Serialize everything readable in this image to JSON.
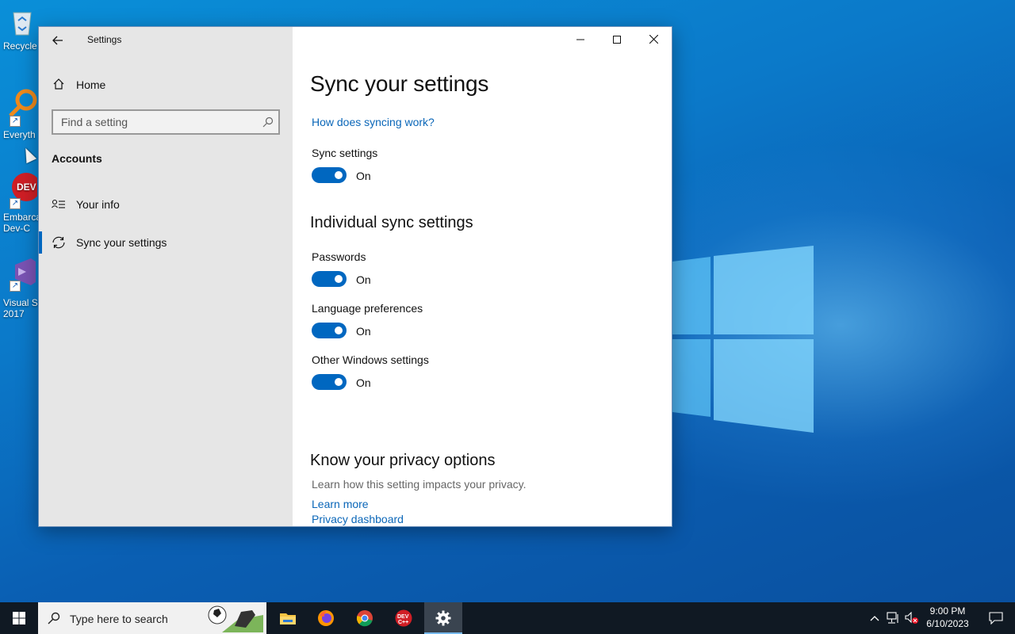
{
  "desktop": {
    "icons": [
      {
        "label": "Recycle"
      },
      {
        "label": "Everyth"
      },
      {
        "label": "Embarca\nDev-C"
      },
      {
        "label": "Visual St\n2017"
      }
    ]
  },
  "window": {
    "title": "Settings",
    "sidebar": {
      "home_label": "Home",
      "search_placeholder": "Find a setting",
      "section_title": "Accounts",
      "items": [
        {
          "label": "Your info",
          "icon": "person-card-icon"
        },
        {
          "label": "Sync your settings",
          "icon": "sync-icon",
          "active": true
        }
      ]
    },
    "content": {
      "title": "Sync your settings",
      "how_link": "How does syncing work?",
      "sync_settings_label": "Sync settings",
      "sync_settings_state": "On",
      "individual_heading": "Individual sync settings",
      "individual": [
        {
          "label": "Passwords",
          "state": "On"
        },
        {
          "label": "Language preferences",
          "state": "On"
        },
        {
          "label": "Other Windows settings",
          "state": "On"
        }
      ],
      "privacy_heading": "Know your privacy options",
      "privacy_text": "Learn how this setting impacts your privacy.",
      "learn_more": "Learn more",
      "privacy_dashboard": "Privacy dashboard"
    },
    "accent": "#0067c0"
  },
  "taskbar": {
    "search_placeholder": "Type here to search",
    "apps": [
      "file-explorer",
      "firefox",
      "chrome",
      "dev-cpp",
      "settings"
    ],
    "time": "9:00 PM",
    "date": "6/10/2023"
  }
}
